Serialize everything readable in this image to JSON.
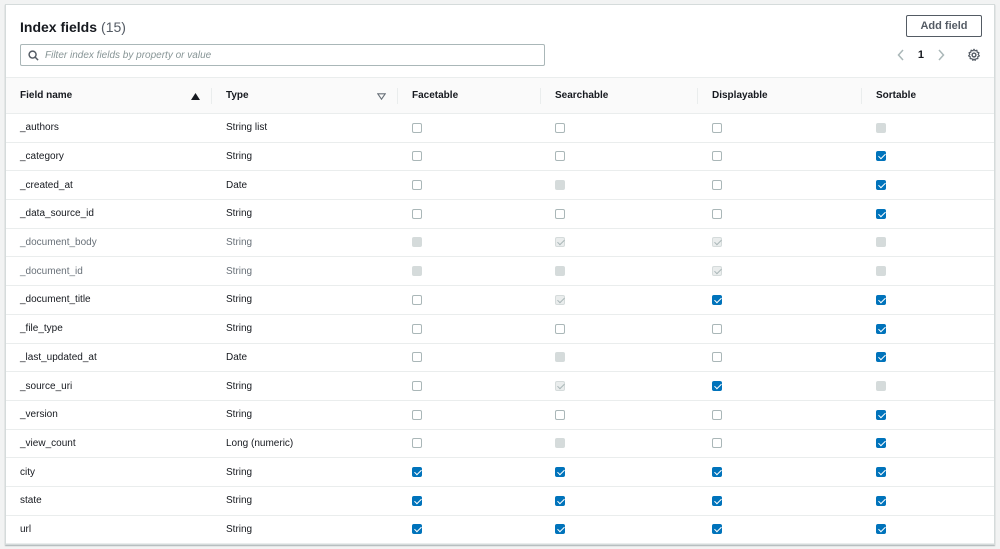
{
  "header": {
    "title": "Index fields",
    "count": "(15)",
    "add_button": "Add field",
    "search_placeholder": "Filter index fields by property or value",
    "page": "1"
  },
  "columns": {
    "field_name": "Field name",
    "type": "Type",
    "facetable": "Facetable",
    "searchable": "Searchable",
    "displayable": "Displayable",
    "sortable": "Sortable"
  },
  "checkbox_states_legend": {
    "off": "unchecked",
    "on": "checked",
    "dis": "disabled unchecked",
    "dison": "disabled checked"
  },
  "rows": [
    {
      "name": "_authors",
      "type": "String list",
      "disabled": false,
      "facetable": "off",
      "searchable": "off",
      "displayable": "off",
      "sortable": "dis"
    },
    {
      "name": "_category",
      "type": "String",
      "disabled": false,
      "facetable": "off",
      "searchable": "off",
      "displayable": "off",
      "sortable": "on"
    },
    {
      "name": "_created_at",
      "type": "Date",
      "disabled": false,
      "facetable": "off",
      "searchable": "dis",
      "displayable": "off",
      "sortable": "on"
    },
    {
      "name": "_data_source_id",
      "type": "String",
      "disabled": false,
      "facetable": "off",
      "searchable": "off",
      "displayable": "off",
      "sortable": "on"
    },
    {
      "name": "_document_body",
      "type": "String",
      "disabled": true,
      "facetable": "dis",
      "searchable": "dison",
      "displayable": "dison",
      "sortable": "dis"
    },
    {
      "name": "_document_id",
      "type": "String",
      "disabled": true,
      "facetable": "dis",
      "searchable": "dis",
      "displayable": "dison",
      "sortable": "dis"
    },
    {
      "name": "_document_title",
      "type": "String",
      "disabled": false,
      "facetable": "off",
      "searchable": "dison",
      "displayable": "on",
      "sortable": "on"
    },
    {
      "name": "_file_type",
      "type": "String",
      "disabled": false,
      "facetable": "off",
      "searchable": "off",
      "displayable": "off",
      "sortable": "on"
    },
    {
      "name": "_last_updated_at",
      "type": "Date",
      "disabled": false,
      "facetable": "off",
      "searchable": "dis",
      "displayable": "off",
      "sortable": "on"
    },
    {
      "name": "_source_uri",
      "type": "String",
      "disabled": false,
      "facetable": "off",
      "searchable": "dison",
      "displayable": "on",
      "sortable": "dis"
    },
    {
      "name": "_version",
      "type": "String",
      "disabled": false,
      "facetable": "off",
      "searchable": "off",
      "displayable": "off",
      "sortable": "on"
    },
    {
      "name": "_view_count",
      "type": "Long (numeric)",
      "disabled": false,
      "facetable": "off",
      "searchable": "dis",
      "displayable": "off",
      "sortable": "on"
    },
    {
      "name": "city",
      "type": "String",
      "disabled": false,
      "facetable": "on",
      "searchable": "on",
      "displayable": "on",
      "sortable": "on"
    },
    {
      "name": "state",
      "type": "String",
      "disabled": false,
      "facetable": "on",
      "searchable": "on",
      "displayable": "on",
      "sortable": "on"
    },
    {
      "name": "url",
      "type": "String",
      "disabled": false,
      "facetable": "on",
      "searchable": "on",
      "displayable": "on",
      "sortable": "on"
    }
  ],
  "colors": {
    "accent": "#0073bb",
    "border": "#eaeded",
    "text": "#16191f",
    "muted": "#687078"
  },
  "icons": [
    "search-icon",
    "sort-ascending-icon",
    "filter-triangle-icon",
    "chevron-left-icon",
    "chevron-right-icon",
    "gear-icon"
  ]
}
